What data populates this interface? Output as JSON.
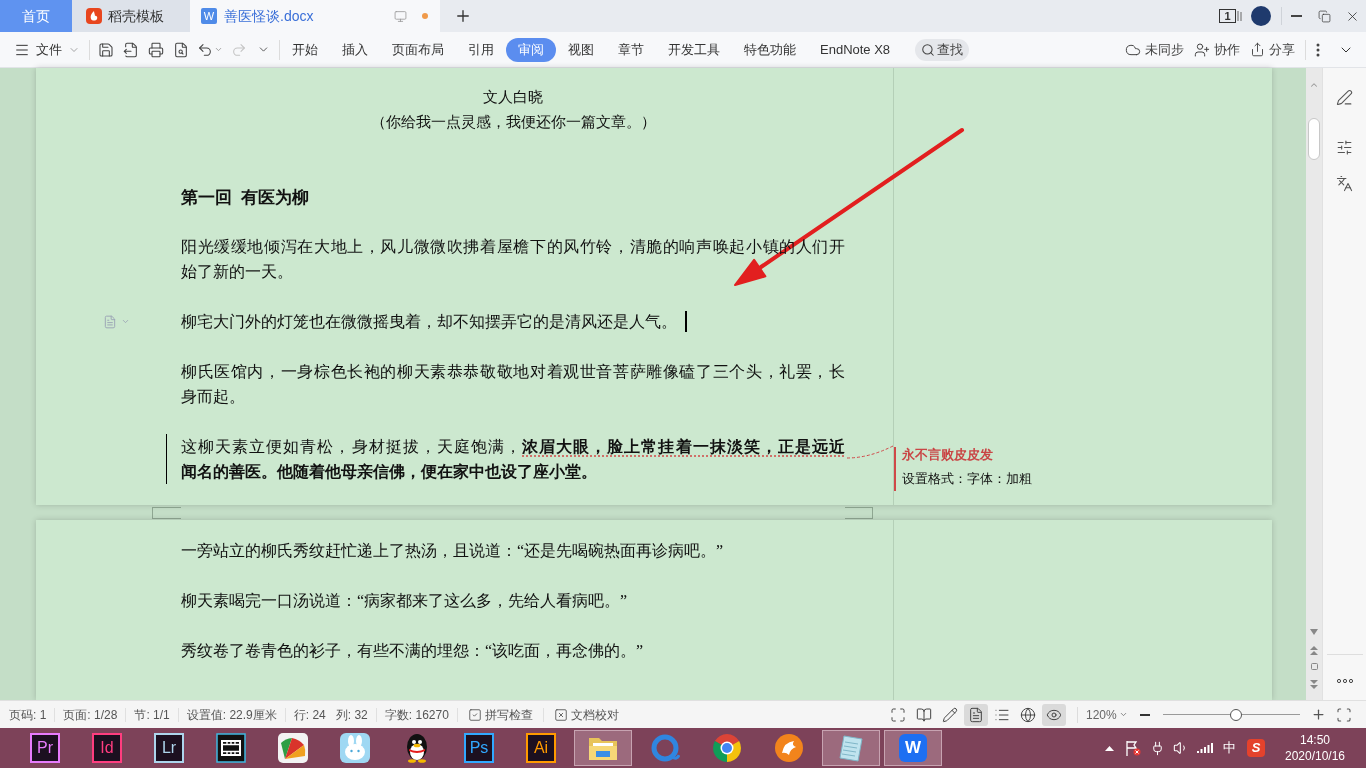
{
  "tabs": [
    {
      "label": "首页",
      "kind": "home",
      "selected": false
    },
    {
      "label": "稻壳模板",
      "kind": "template",
      "selected": false
    },
    {
      "label": "善医怪谈.docx",
      "kind": "document",
      "icon_letter": "W",
      "unsaved": true,
      "selected": true
    }
  ],
  "title_bar": {
    "window_badge": "1"
  },
  "toolbar": {
    "file_menu": "文件",
    "quick_actions": [
      {
        "kind": "save",
        "disabled": false
      },
      {
        "kind": "export",
        "disabled": false
      },
      {
        "kind": "print",
        "disabled": false
      },
      {
        "kind": "preview",
        "disabled": false
      },
      {
        "kind": "undo",
        "disabled": false
      },
      {
        "kind": "redo",
        "disabled": true
      },
      {
        "kind": "more",
        "disabled": false
      }
    ],
    "ribbon_tabs": [
      {
        "label": "开始",
        "selected": false
      },
      {
        "label": "插入",
        "selected": false
      },
      {
        "label": "页面布局",
        "selected": false
      },
      {
        "label": "引用",
        "selected": false
      },
      {
        "label": "审阅",
        "selected": true
      },
      {
        "label": "视图",
        "selected": false
      },
      {
        "label": "章节",
        "selected": false
      },
      {
        "label": "开发工具",
        "selected": false
      },
      {
        "label": "特色功能",
        "selected": false
      },
      {
        "label": "EndNote X8",
        "selected": false
      }
    ],
    "search": "查找",
    "actions": [
      {
        "kind": "cloud",
        "label": "未同步"
      },
      {
        "kind": "collab",
        "label": "协作"
      },
      {
        "kind": "share",
        "label": "分享"
      }
    ]
  },
  "document": {
    "byline": "文人白晓",
    "subtitle": "（你给我一点灵感，我便还你一篇文章。）",
    "heading": "第一回  有医为柳",
    "pages": [
      {
        "paragraphs": [
          {
            "lines": [
              "阳光缓缓地倾泻在大地上，风儿微微吹拂着屋檐下的风竹铃，清脆的响声唤起小镇的人们开",
              "始了新的一天。"
            ],
            "cursor": false,
            "changed": false
          },
          {
            "lines": [
              "柳宅大门外的灯笼也在微微摇曳着，却不知摆弄它的是清风还是人气。"
            ],
            "cursor": true,
            "changed": false
          },
          {
            "lines": [
              "柳氏医馆内，一身棕色长袍的柳天素恭恭敬敬地对着观世音菩萨雕像磕了三个头，礼罢，长",
              "身而起。"
            ],
            "cursor": false,
            "changed": false
          },
          {
            "lines": [
              "这柳天素立便如青松，身材挺拔，天庭饱满，**浓眉大眼，脸上常挂着一抹淡笑，正是远近**",
              "**闻名的善医。他随着他母亲信佛，便在家中也设了座小堂。**"
            ],
            "cursor": false,
            "changed": true
          }
        ]
      },
      {
        "paragraphs": [
          {
            "lines": [
              "一旁站立的柳氏秀纹赶忙递上了热汤，且说道：“还是先喝碗热面再诊病吧。”"
            ],
            "cursor": false,
            "changed": false
          },
          {
            "lines": [
              "柳天素喝完一口汤说道：“病家都来了这么多，先给人看病吧。”"
            ],
            "cursor": false,
            "changed": false
          },
          {
            "lines": [
              "秀纹卷了卷青色的衫子，有些不满的埋怨：“该吃面，再念佛的。”"
            ],
            "cursor": false,
            "changed": false
          }
        ]
      }
    ],
    "comment": {
      "author": "永不言败皮皮发",
      "text": "设置格式：字体：加粗"
    }
  },
  "status_bar": {
    "fields": [
      [
        "页码: 1"
      ],
      [
        "页面: 1/28"
      ],
      [
        "节: 1/1"
      ],
      [
        "设置值: 22.9厘米"
      ],
      [
        "行: 24",
        "列: 32"
      ],
      [
        "字数: 16270"
      ]
    ],
    "checks": [
      {
        "kind": "spell",
        "label": "拼写检查"
      },
      {
        "kind": "proof",
        "label": "文档校对"
      }
    ],
    "views": [
      {
        "kind": "fullscreen",
        "selected": false
      },
      {
        "kind": "reading",
        "selected": false
      },
      {
        "kind": "edit",
        "selected": false
      },
      {
        "kind": "page",
        "selected": true
      },
      {
        "kind": "outline",
        "selected": false
      },
      {
        "kind": "web",
        "selected": false
      },
      {
        "kind": "eye-care",
        "selected": true
      }
    ],
    "zoom": {
      "reading": "120%",
      "level": 0.53
    }
  },
  "taskbar": {
    "apps": [
      {
        "kind": "logo",
        "label": "Pr",
        "color": "#e77bfc",
        "running": false
      },
      {
        "kind": "logo",
        "label": "Id",
        "color": "#ff3d7f",
        "running": false
      },
      {
        "kind": "logo",
        "label": "Lr",
        "color": "#add5ec",
        "running": false
      },
      {
        "kind": "film",
        "running": false
      },
      {
        "kind": "fan",
        "running": false
      },
      {
        "kind": "rabbit",
        "running": false
      },
      {
        "kind": "penguin",
        "running": false
      },
      {
        "kind": "logo",
        "label": "Ps",
        "color": "#31a8ff",
        "running": false
      },
      {
        "kind": "logo",
        "label": "Ai",
        "color": "#ff9a00",
        "running": false
      },
      {
        "kind": "folder",
        "running": true
      },
      {
        "kind": "ring",
        "running": false
      },
      {
        "kind": "chrome",
        "running": false
      },
      {
        "kind": "orange",
        "running": false
      },
      {
        "kind": "notepad",
        "running": true
      },
      {
        "kind": "wps",
        "label": "W",
        "running": true
      }
    ],
    "tray": {
      "ime": "中",
      "ime_logo": "S",
      "time": "14:50",
      "date": "2020/10/16"
    }
  }
}
